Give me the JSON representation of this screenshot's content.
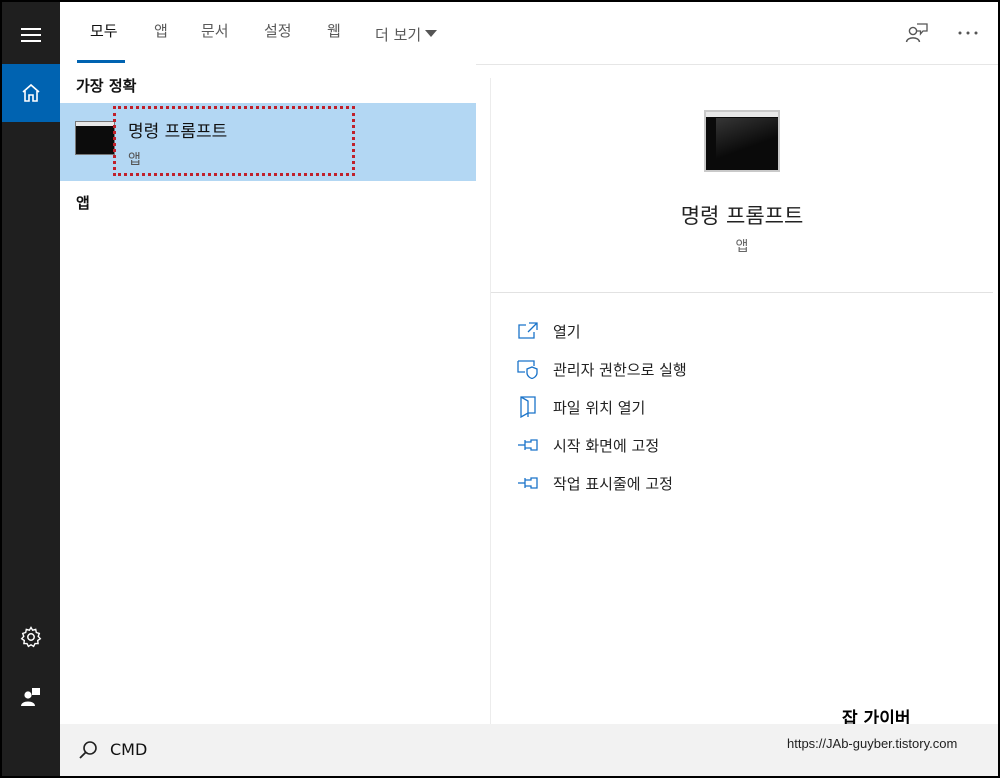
{
  "tabs": [
    {
      "label": "모두"
    },
    {
      "label": "앱"
    },
    {
      "label": "문서"
    },
    {
      "label": "설정"
    },
    {
      "label": "웹"
    },
    {
      "label": "더 보기"
    }
  ],
  "icons": {
    "menu": "hamburger-icon",
    "home": "home-icon",
    "settings": "gear-icon",
    "user": "user-icon",
    "feedback": "feedback-icon",
    "more": "ellipsis-icon",
    "search": "search-icon"
  },
  "results": {
    "best_match_heading": "가장 정확",
    "apps_heading": "앱",
    "best_match": {
      "name": "명령 프롬프트",
      "type": "앱"
    }
  },
  "preview": {
    "name": "명령 프롬프트",
    "type": "앱",
    "actions": [
      {
        "label": "열기",
        "icon": "open-icon"
      },
      {
        "label": "관리자 권한으로 실행",
        "icon": "admin-shield-icon"
      },
      {
        "label": "파일 위치 열기",
        "icon": "file-location-icon"
      },
      {
        "label": "시작 화면에 고정",
        "icon": "pin-icon"
      },
      {
        "label": "작업 표시줄에 고정",
        "icon": "pin-icon"
      }
    ]
  },
  "search": {
    "query": "CMD"
  },
  "watermark": {
    "title": "잡 가이버",
    "url": "https://JAb-guyber.tistory.com"
  },
  "colors": {
    "sidebar": "#1f1f1f",
    "accent": "#0063b1",
    "selected_result": "#b3d7f3",
    "highlight_border": "#c0202a"
  }
}
